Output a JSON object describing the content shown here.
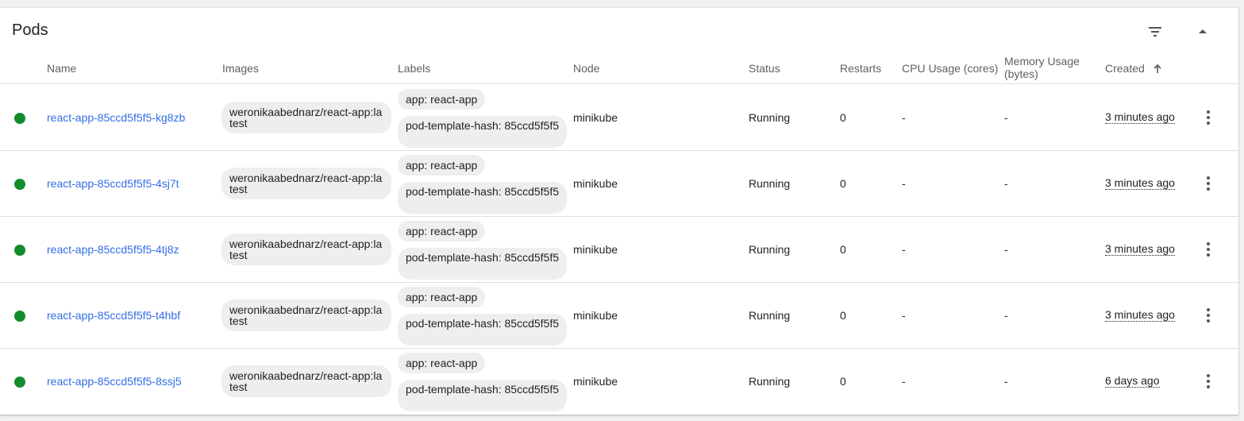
{
  "card": {
    "title": "Pods"
  },
  "icons": {
    "filter": "filter-icon",
    "collapse": "arrow-up-icon",
    "row_menu": "more-vert-icon",
    "sort": "arrow-upward-icon"
  },
  "colors": {
    "running": "#138c2c",
    "link": "#326de6"
  },
  "columns": {
    "name": "Name",
    "images": "Images",
    "labels": "Labels",
    "node": "Node",
    "status": "Status",
    "restarts": "Restarts",
    "cpu": "CPU Usage (cores)",
    "memory_line1": "Memory Usage",
    "memory_line2": "(bytes)",
    "created": "Created"
  },
  "pods": [
    {
      "name": "react-app-85ccd5f5f5-kg8zb",
      "image": "weronikaabednarz/react-app:latest",
      "label_app": "app: react-app",
      "label_hash": "pod-template-hash: 85ccd5f5f5",
      "node": "minikube",
      "status": "Running",
      "restarts": "0",
      "cpu": "-",
      "memory": "-",
      "created": "3 minutes ago"
    },
    {
      "name": "react-app-85ccd5f5f5-4sj7t",
      "image": "weronikaabednarz/react-app:latest",
      "label_app": "app: react-app",
      "label_hash": "pod-template-hash: 85ccd5f5f5",
      "node": "minikube",
      "status": "Running",
      "restarts": "0",
      "cpu": "-",
      "memory": "-",
      "created": "3 minutes ago"
    },
    {
      "name": "react-app-85ccd5f5f5-4tj8z",
      "image": "weronikaabednarz/react-app:latest",
      "label_app": "app: react-app",
      "label_hash": "pod-template-hash: 85ccd5f5f5",
      "node": "minikube",
      "status": "Running",
      "restarts": "0",
      "cpu": "-",
      "memory": "-",
      "created": "3 minutes ago"
    },
    {
      "name": "react-app-85ccd5f5f5-t4hbf",
      "image": "weronikaabednarz/react-app:latest",
      "label_app": "app: react-app",
      "label_hash": "pod-template-hash: 85ccd5f5f5",
      "node": "minikube",
      "status": "Running",
      "restarts": "0",
      "cpu": "-",
      "memory": "-",
      "created": "3 minutes ago"
    },
    {
      "name": "react-app-85ccd5f5f5-8ssj5",
      "image": "weronikaabednarz/react-app:latest",
      "label_app": "app: react-app",
      "label_hash": "pod-template-hash: 85ccd5f5f5",
      "node": "minikube",
      "status": "Running",
      "restarts": "0",
      "cpu": "-",
      "memory": "-",
      "created": "6 days ago"
    }
  ]
}
